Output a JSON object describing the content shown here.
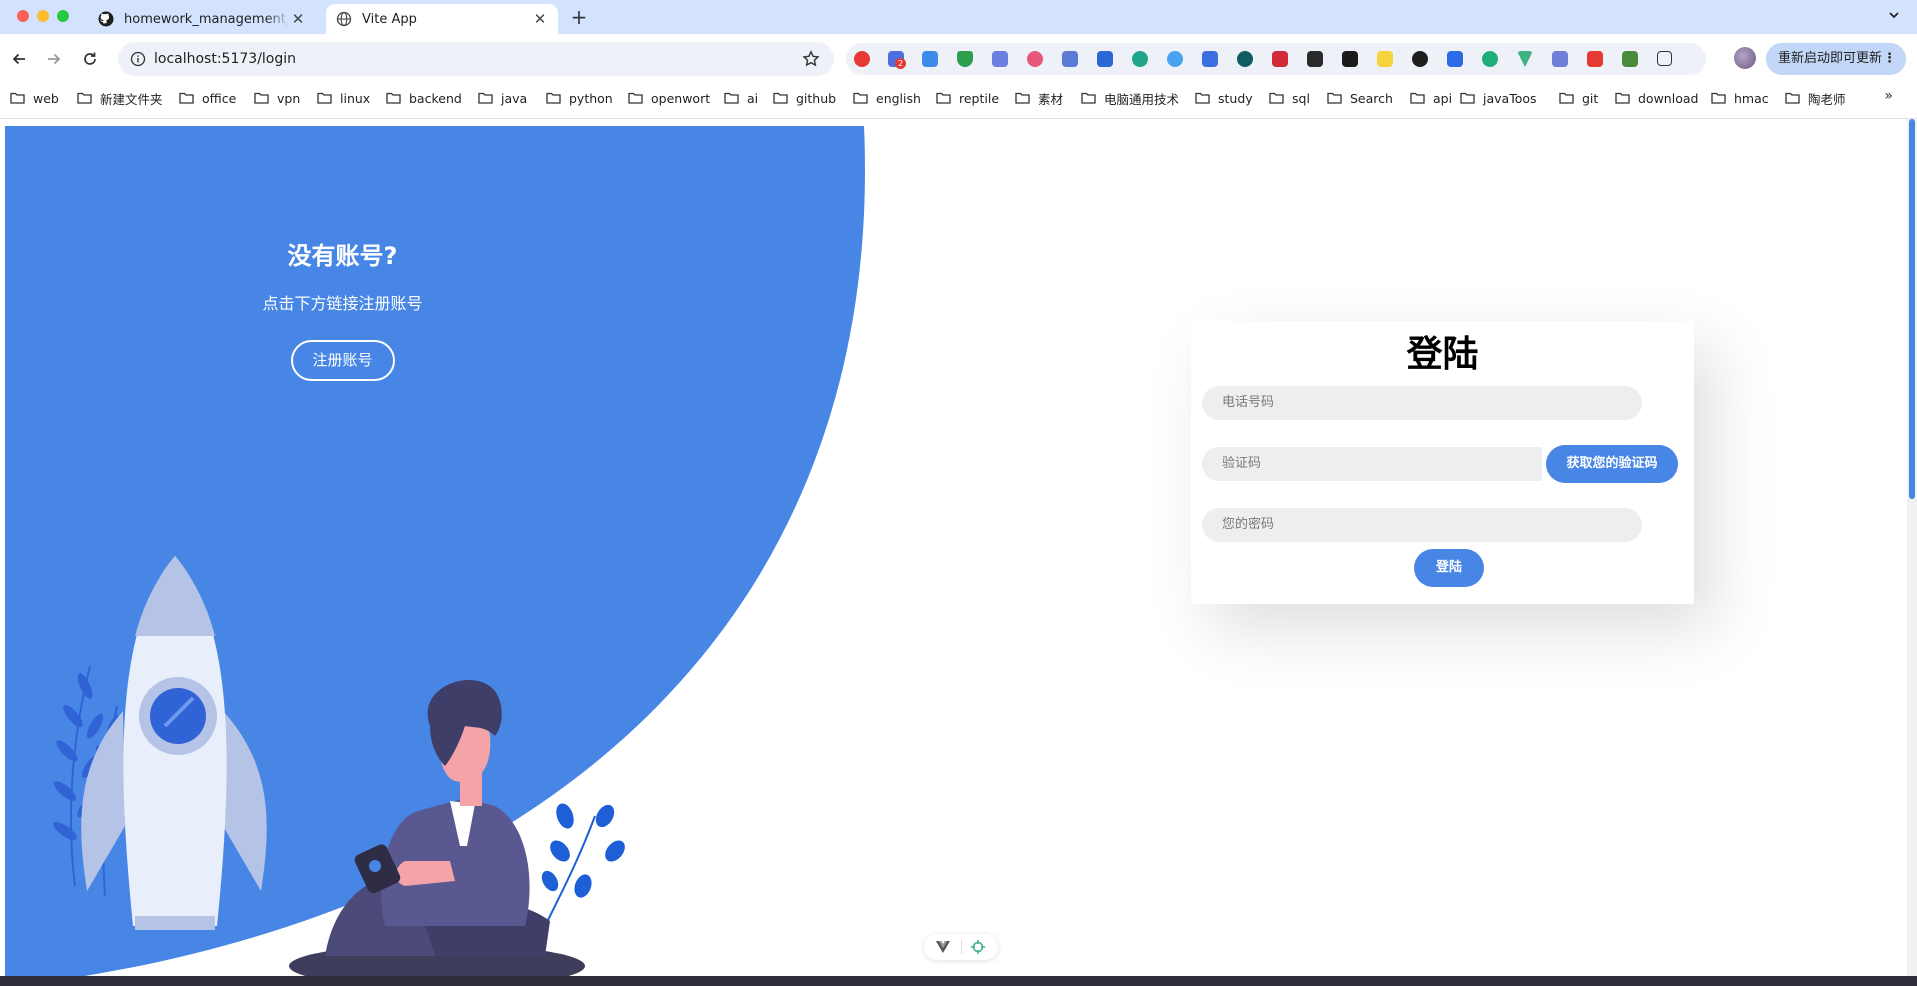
{
  "browser": {
    "tabs": [
      {
        "title": "homework_management_system",
        "favicon": "github-icon",
        "active": false
      },
      {
        "title": "Vite App",
        "favicon": "globe-icon",
        "active": true
      }
    ],
    "new_tab_label": "+",
    "tab_search_icon": "chevron-down-icon",
    "url": "localhost:5173/login",
    "update_button_label": "重新启动即可更新",
    "update_menu_icon": "⋮",
    "extension_badge": "2"
  },
  "bookmarks": [
    "web",
    "新建文件夹",
    "office",
    "vpn",
    "linux",
    "backend",
    "java",
    "python",
    "openwort",
    "ai",
    "github",
    "english",
    "reptile",
    "素材",
    "电脑通用技术",
    "study",
    "sql",
    "Search",
    "api",
    "javaToos",
    "git",
    "download",
    "hmac",
    "陶老师"
  ],
  "bookmarks_more": "»",
  "left_panel": {
    "title": "没有账号?",
    "subtitle": "点击下方链接注册账号",
    "register_button": "注册账号"
  },
  "login_form": {
    "title": "登陆",
    "phone_placeholder": "电话号码",
    "code_placeholder": "验证码",
    "get_code_button": "获取您的验证码",
    "password_placeholder": "您的密码",
    "submit_button": "登陆"
  },
  "colors": {
    "accent": "#4886e6",
    "tab_strip": "#d3e3fd",
    "field_bg": "#eeeeee",
    "illustration_dark": "#4b4a78",
    "illustration_skin": "#f4a3a8"
  }
}
